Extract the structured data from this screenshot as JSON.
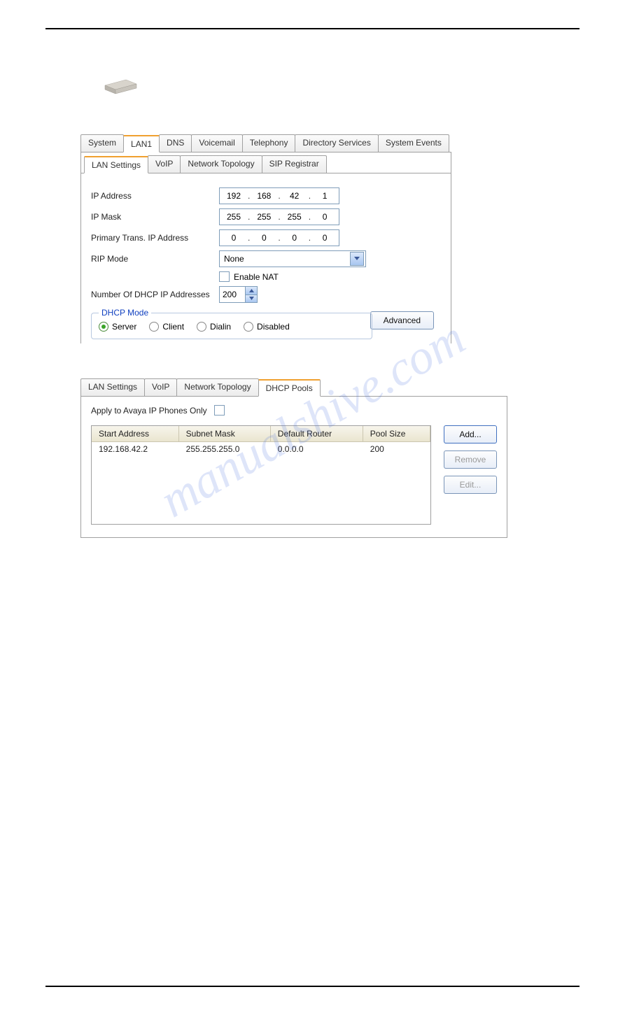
{
  "watermark": "manualshive.com",
  "top_tabs": [
    "System",
    "LAN1",
    "DNS",
    "Voicemail",
    "Telephony",
    "Directory Services",
    "System Events"
  ],
  "top_tabs_active_index": 1,
  "sub_tabs": [
    "LAN Settings",
    "VoIP",
    "Network Topology",
    "SIP Registrar"
  ],
  "sub_tabs_active_index": 0,
  "lan": {
    "ip_address_label": "IP Address",
    "ip_address": [
      "192",
      "168",
      "42",
      "1"
    ],
    "ip_mask_label": "IP Mask",
    "ip_mask": [
      "255",
      "255",
      "255",
      "0"
    ],
    "primary_trans_label": "Primary Trans. IP Address",
    "primary_trans": [
      "0",
      "0",
      "0",
      "0"
    ],
    "rip_mode_label": "RIP Mode",
    "rip_mode_value": "None",
    "enable_nat_label": "Enable NAT",
    "enable_nat_checked": false,
    "num_dhcp_label": "Number Of DHCP IP Addresses",
    "num_dhcp_value": "200"
  },
  "dhcp_mode": {
    "legend": "DHCP Mode",
    "options": [
      "Server",
      "Client",
      "Dialin",
      "Disabled"
    ],
    "selected_index": 0
  },
  "advanced_button": "Advanced",
  "sub_tabs2": [
    "LAN Settings",
    "VoIP",
    "Network Topology",
    "DHCP Pools"
  ],
  "sub_tabs2_active_index": 3,
  "dhcp_pools": {
    "apply_label": "Apply to Avaya IP Phones Only",
    "apply_checked": false,
    "columns": [
      "Start Address",
      "Subnet Mask",
      "Default Router",
      "Pool Size"
    ],
    "rows": [
      {
        "start": "192.168.42.2",
        "mask": "255.255.255.0",
        "router": "0.0.0.0",
        "size": "200"
      }
    ],
    "buttons": {
      "add": "Add...",
      "remove": "Remove",
      "edit": "Edit..."
    }
  }
}
